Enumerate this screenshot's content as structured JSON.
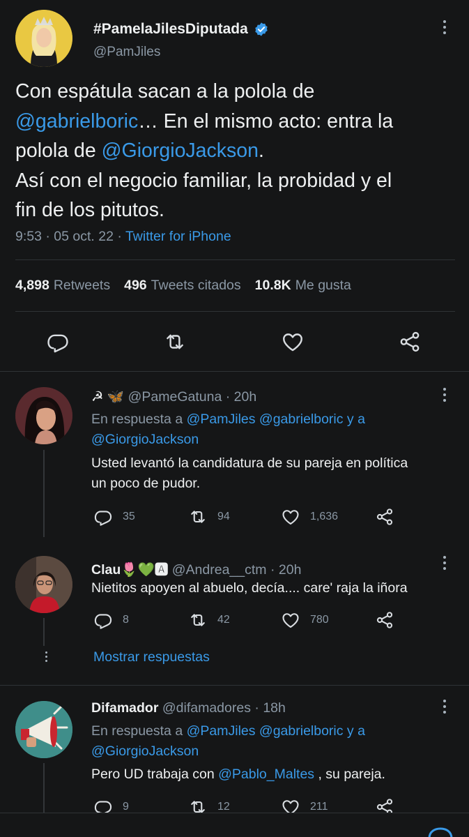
{
  "main_tweet": {
    "display_name": "#PamelaJilesDiputada",
    "handle": "@PamJiles",
    "text_lines": [
      {
        "parts": [
          {
            "t": "Con espátula sacan a la polola de",
            "link": false
          }
        ]
      },
      {
        "parts": [
          {
            "t": "@gabrielboric",
            "link": true
          },
          {
            "t": "… En el mismo acto: entra la",
            "link": false
          }
        ]
      },
      {
        "parts": [
          {
            "t": "polola de ",
            "link": false
          },
          {
            "t": "@GiorgioJackson",
            "link": true
          },
          {
            "t": ".",
            "link": false
          }
        ]
      },
      {
        "parts": [
          {
            "t": "Así con el negocio familiar, la probidad y el",
            "link": false
          }
        ]
      },
      {
        "parts": [
          {
            "t": "fin de los pitutos.",
            "link": false
          }
        ]
      }
    ],
    "time": "9:53",
    "date": "05 oct. 22",
    "source": "Twitter for iPhone",
    "retweets_count": "4,898",
    "retweets_label": "Retweets",
    "quotes_count": "496",
    "quotes_label": "Tweets citados",
    "likes_count": "10.8K",
    "likes_label": "Me gusta"
  },
  "replies": [
    {
      "name_emoji": "☭ 🦋",
      "handle": "@PameGatuna",
      "time": "20h",
      "reply_to_label": "En respuesta a",
      "reply_to": "@PamJiles @gabrielboric y a",
      "reply_to_2": "@GiorgioJackson",
      "text_1": "Usted levantó la candidatura de su pareja en política",
      "text_2": "un poco de pudor.",
      "replies": "35",
      "retweets": "94",
      "likes": "1,636"
    },
    {
      "name": "Clau",
      "name_emoji": "🌷💚🅰",
      "handle": "@Andrea__ctm",
      "time": "20h",
      "text_1": "Nietitos apoyen al abuelo, decía.... care' raja la iñora",
      "replies": "8",
      "retweets": "42",
      "likes": "780"
    },
    {
      "name": "Difamador",
      "handle": "@difamadores",
      "time": "18h",
      "reply_to_label": "En respuesta a",
      "reply_to": "@PamJiles @gabrielboric y a",
      "reply_to_2": "@GiorgioJackson",
      "text_prefix": "Pero UD trabaja con ",
      "text_mention": "@Pablo_Maltes",
      "text_suffix": " , su pareja.",
      "replies": "9",
      "retweets": "12",
      "likes": "211"
    }
  ],
  "show_more_label": "Mostrar respuestas",
  "colors": {
    "background": "#151617",
    "link": "#3a9ae8",
    "muted": "#8b98a5",
    "text": "#eef0f1"
  }
}
